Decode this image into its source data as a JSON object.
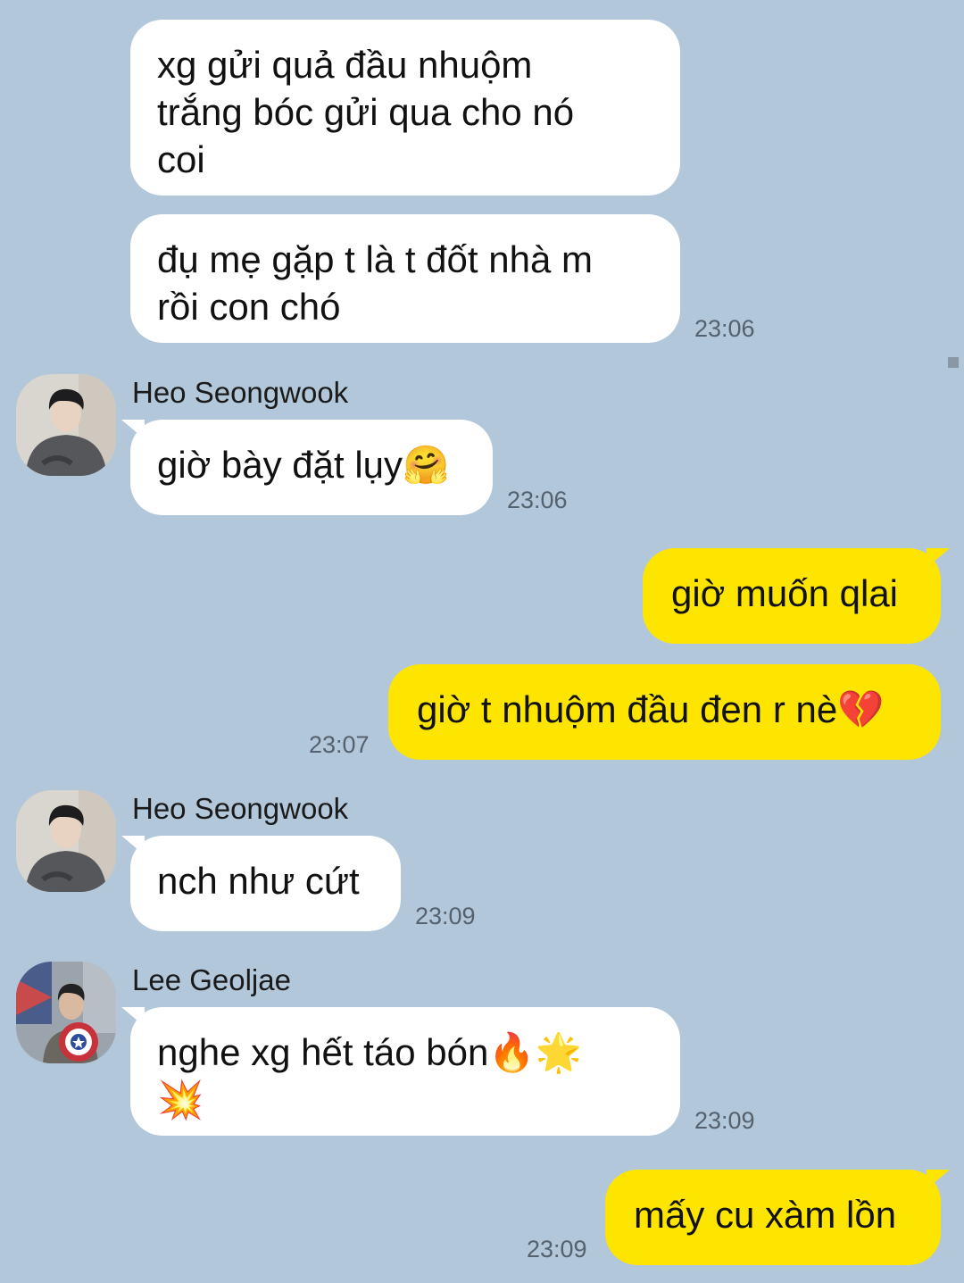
{
  "messages": [
    {
      "direction": "incoming",
      "lines": [
        "xg gửi quả đầu nhuộm",
        "trắng bóc gửi qua cho nó",
        "coi"
      ]
    },
    {
      "direction": "incoming",
      "lines": [
        "đụ mẹ gặp t là t đốt nhà m",
        "rồi con chó"
      ],
      "time": "23:06"
    },
    {
      "direction": "incoming",
      "sender": "Heo Seongwook",
      "lines": [
        "giờ bày đặt lụy🤗"
      ],
      "time": "23:06"
    },
    {
      "direction": "outgoing",
      "lines": [
        "giờ muốn qlai"
      ]
    },
    {
      "direction": "outgoing",
      "lines": [
        "giờ t nhuộm đầu đen r nè💔"
      ],
      "time": "23:07"
    },
    {
      "direction": "incoming",
      "sender": "Heo Seongwook",
      "lines": [
        "nch như cứt"
      ],
      "time": "23:09"
    },
    {
      "direction": "incoming",
      "sender": "Lee Geoljae",
      "lines": [
        "nghe xg hết táo bón🔥🌟",
        "💥"
      ],
      "time": "23:09"
    },
    {
      "direction": "outgoing",
      "lines": [
        "mấy cu xàm lồn"
      ],
      "time": "23:09"
    }
  ],
  "colors": {
    "background": "#b2c7da",
    "incoming_bubble": "#ffffff",
    "outgoing_bubble": "#fee500",
    "timestamp": "#55616d"
  }
}
